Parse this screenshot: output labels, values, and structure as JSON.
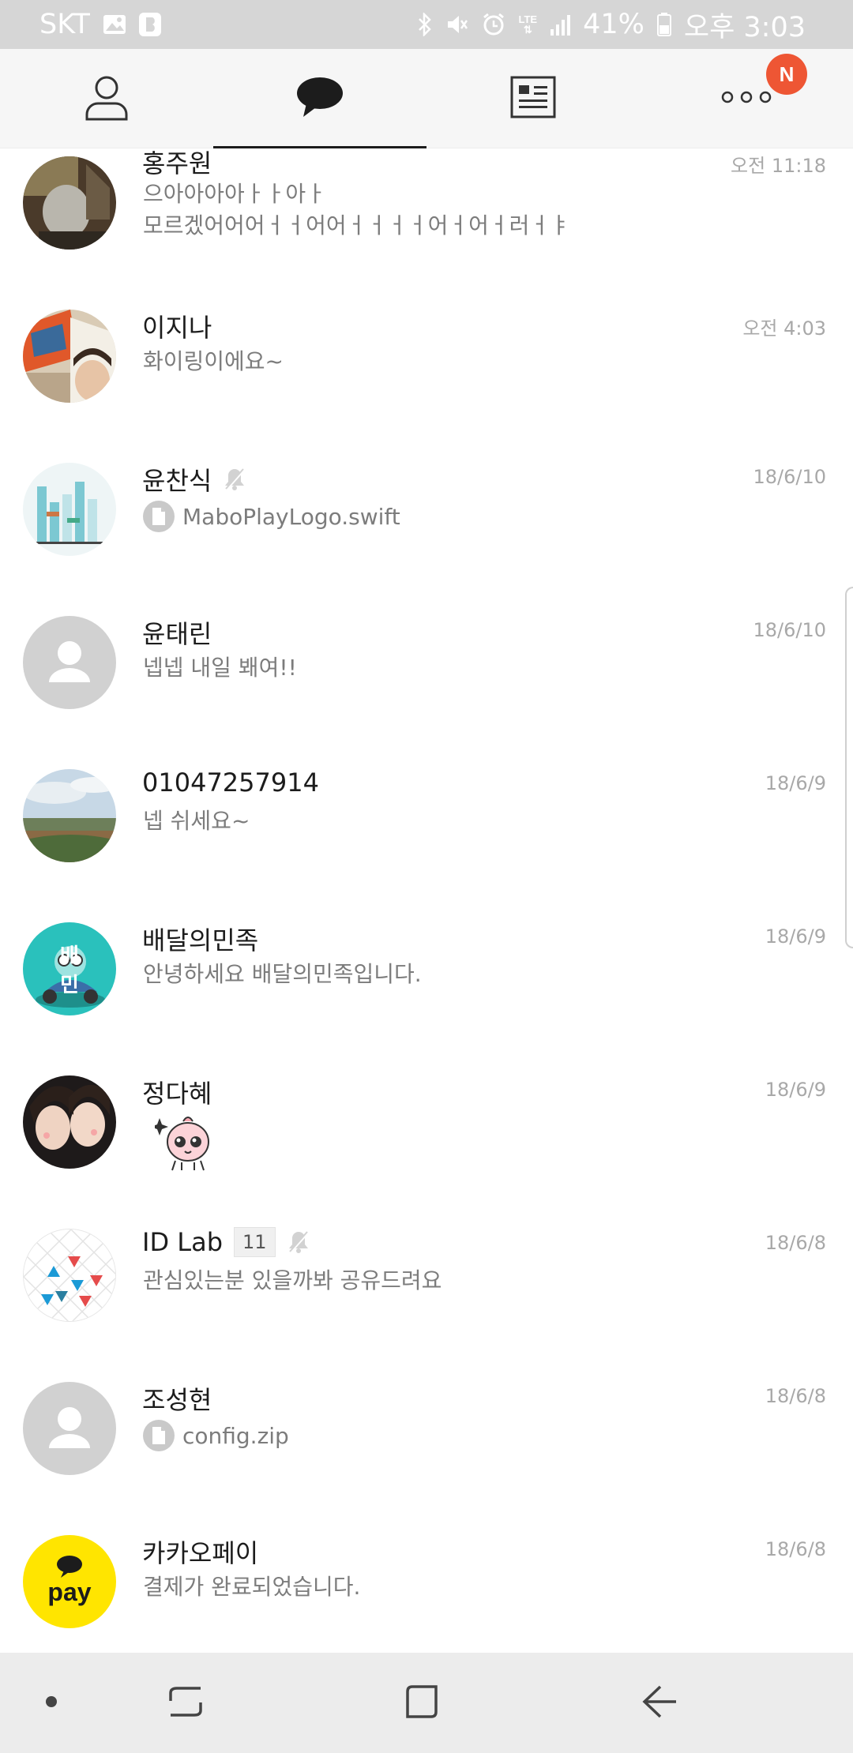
{
  "status_bar": {
    "carrier": "SKT",
    "network": "LTE",
    "battery": "41%",
    "time": "오후 3:03",
    "icons": [
      "image-icon",
      "b-app-icon",
      "bluetooth-icon",
      "mute-icon",
      "alarm-icon",
      "lte-icon",
      "signal-icon",
      "battery-icon"
    ]
  },
  "tabs": [
    {
      "name": "friends",
      "icon": "person-icon"
    },
    {
      "name": "chats",
      "icon": "chat-bubble-icon",
      "active": true
    },
    {
      "name": "news",
      "icon": "news-list-icon"
    },
    {
      "name": "more",
      "icon": "more-dots-icon",
      "badge": "N"
    }
  ],
  "colors": {
    "badge": "#ee5634",
    "kakaopay": "#ffe500",
    "name_text": "#1c1c1c",
    "preview_text": "#7c7c7c",
    "time_text": "#a8a8a8"
  },
  "chats": [
    {
      "name": "홍주원",
      "time": "오전 11:18",
      "preview": "으아아아아ㅏㅏ아ㅏ\n모르겠어어어ㅓㅓ어어ㅓㅓㅓㅓ어ㅓ어ㅓ러ㅓㅑ"
    },
    {
      "name": "이지나",
      "time": "오전 4:03",
      "preview": "화이링이에요~"
    },
    {
      "name": "윤찬식",
      "time": "18/6/10",
      "muted": true,
      "file": "MaboPlayLogo.swift"
    },
    {
      "name": "윤태린",
      "time": "18/6/10",
      "preview": "넵넵 내일 봬여!!"
    },
    {
      "name": "01047257914",
      "time": "18/6/9",
      "preview": "넵 쉬세요~"
    },
    {
      "name": "배달의민족",
      "time": "18/6/9",
      "preview": "안녕하세요 배달의민족입니다.",
      "avatar_text": "배 민"
    },
    {
      "name": "정다혜",
      "time": "18/6/9",
      "preview_type": "sticker"
    },
    {
      "name": "ID Lab",
      "time": "18/6/8",
      "member_count": "11",
      "muted": true,
      "preview": "관심있는분 있을까봐 공유드려요"
    },
    {
      "name": "조성현",
      "time": "18/6/8",
      "file": "config.zip"
    },
    {
      "name": "카카오페이",
      "time": "18/6/8",
      "preview": "결제가 완료되었습니다.",
      "avatar_text": "pay"
    }
  ],
  "nav_bar": {
    "buttons": [
      "dot-icon",
      "recent-apps-icon",
      "home-icon",
      "back-icon"
    ]
  }
}
